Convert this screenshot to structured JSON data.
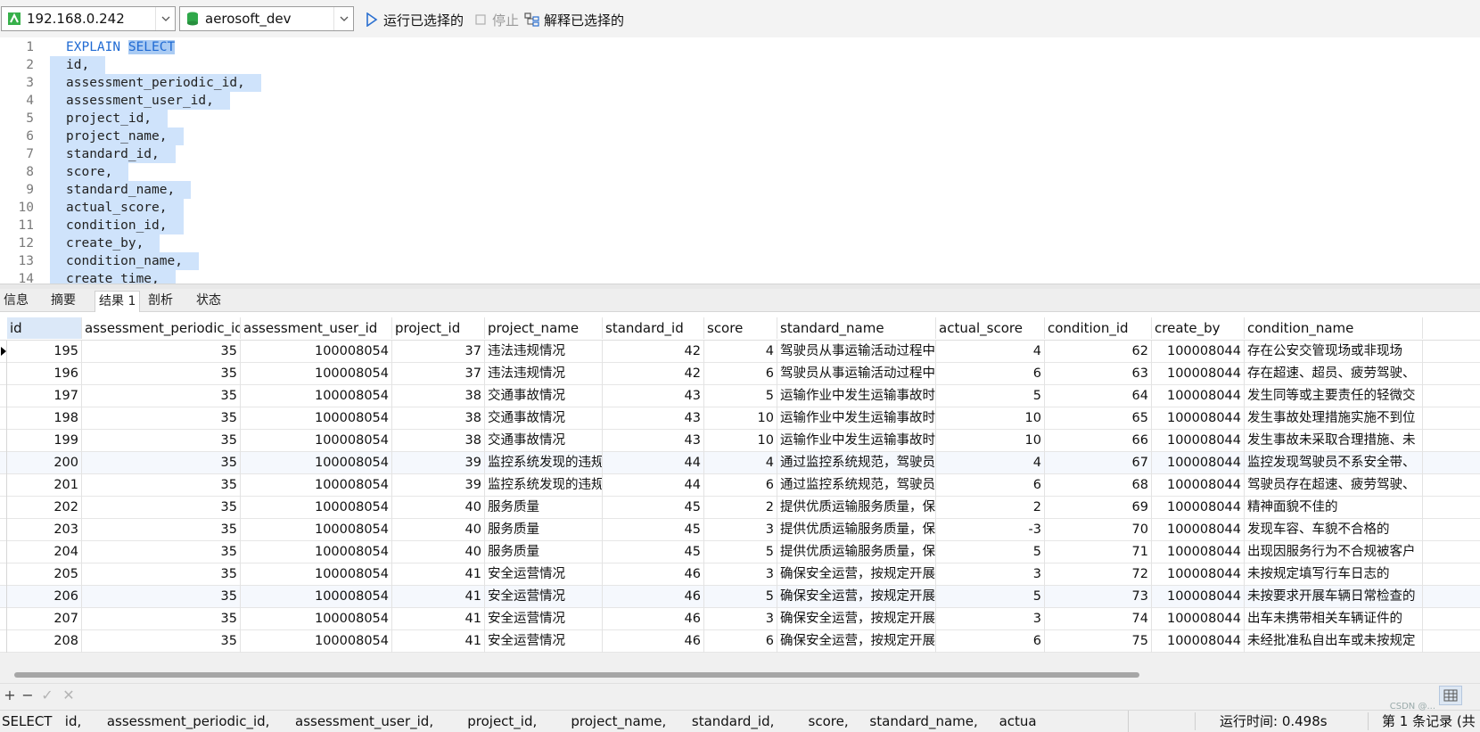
{
  "toolbar": {
    "connection": "192.168.0.242",
    "database": "aerosoft_dev",
    "run_selected": "运行已选择的",
    "stop": "停止",
    "explain_selected": "解释已选择的"
  },
  "editor": {
    "lines": [
      {
        "n": "1",
        "kw": "EXPLAIN",
        "kw2": "SELECT",
        "text": ""
      },
      {
        "n": "2",
        "text": "id,"
      },
      {
        "n": "3",
        "text": "assessment_periodic_id,"
      },
      {
        "n": "4",
        "text": "assessment_user_id,"
      },
      {
        "n": "5",
        "text": "project_id,"
      },
      {
        "n": "6",
        "text": "project_name,"
      },
      {
        "n": "7",
        "text": "standard_id,"
      },
      {
        "n": "8",
        "text": "score,"
      },
      {
        "n": "9",
        "text": "standard_name,"
      },
      {
        "n": "10",
        "text": "actual_score,"
      },
      {
        "n": "11",
        "text": "condition_id,"
      },
      {
        "n": "12",
        "text": "create_by,"
      },
      {
        "n": "13",
        "text": "condition_name,"
      },
      {
        "n": "14",
        "text": "create_time,"
      }
    ]
  },
  "tabs": [
    "信息",
    "摘要",
    "结果 1",
    "剖析",
    "状态"
  ],
  "active_tab": "结果 1",
  "grid": {
    "columns": [
      "id",
      "assessment_periodic_id",
      "assessment_user_id",
      "project_id",
      "project_name",
      "standard_id",
      "score",
      "standard_name",
      "actual_score",
      "condition_id",
      "create_by",
      "condition_name"
    ],
    "rows": [
      [
        "195",
        "35",
        "100008054",
        "37",
        "违法违规情况",
        "42",
        "4",
        "驾驶员从事运输活动过程中,",
        "4",
        "62",
        "100008044",
        "存在公安交管现场或非现场"
      ],
      [
        "196",
        "35",
        "100008054",
        "37",
        "违法违规情况",
        "42",
        "6",
        "驾驶员从事运输活动过程中,",
        "6",
        "63",
        "100008044",
        "存在超速、超员、疲劳驾驶、"
      ],
      [
        "197",
        "35",
        "100008054",
        "38",
        "交通事故情况",
        "43",
        "5",
        "运输作业中发生运输事故时及",
        "5",
        "64",
        "100008044",
        "发生同等或主要责任的轻微交"
      ],
      [
        "198",
        "35",
        "100008054",
        "38",
        "交通事故情况",
        "43",
        "10",
        "运输作业中发生运输事故时及",
        "10",
        "65",
        "100008044",
        "发生事故处理措施实施不到位"
      ],
      [
        "199",
        "35",
        "100008054",
        "38",
        "交通事故情况",
        "43",
        "10",
        "运输作业中发生运输事故时及",
        "10",
        "66",
        "100008044",
        "发生事故未采取合理措施、未"
      ],
      [
        "200",
        "35",
        "100008054",
        "39",
        "监控系统发现的违规",
        "44",
        "4",
        "通过监控系统规范，驾驶员和",
        "4",
        "67",
        "100008044",
        "监控发现驾驶员不系安全带、"
      ],
      [
        "201",
        "35",
        "100008054",
        "39",
        "监控系统发现的违规",
        "44",
        "6",
        "通过监控系统规范，驾驶员和",
        "6",
        "68",
        "100008044",
        "驾驶员存在超速、疲劳驾驶、"
      ],
      [
        "202",
        "35",
        "100008054",
        "40",
        "服务质量",
        "45",
        "2",
        "提供优质运输服务质量，保持",
        "2",
        "69",
        "100008044",
        "精神面貌不佳的"
      ],
      [
        "203",
        "35",
        "100008054",
        "40",
        "服务质量",
        "45",
        "3",
        "提供优质运输服务质量，保持",
        "-3",
        "70",
        "100008044",
        "发现车容、车貌不合格的"
      ],
      [
        "204",
        "35",
        "100008054",
        "40",
        "服务质量",
        "45",
        "5",
        "提供优质运输服务质量，保持",
        "5",
        "71",
        "100008044",
        "出现因服务行为不合规被客户"
      ],
      [
        "205",
        "35",
        "100008054",
        "41",
        "安全运营情况",
        "46",
        "3",
        "确保安全运营，按规定开展安",
        "3",
        "72",
        "100008044",
        "未按规定填写行车日志的"
      ],
      [
        "206",
        "35",
        "100008054",
        "41",
        "安全运营情况",
        "46",
        "5",
        "确保安全运营，按规定开展安",
        "5",
        "73",
        "100008044",
        "未按要求开展车辆日常检查的"
      ],
      [
        "207",
        "35",
        "100008054",
        "41",
        "安全运营情况",
        "46",
        "3",
        "确保安全运营，按规定开展安",
        "3",
        "74",
        "100008044",
        "出车未携带相关车辆证件的"
      ],
      [
        "208",
        "35",
        "100008054",
        "41",
        "安全运营情况",
        "46",
        "6",
        "确保安全运营，按规定开展安",
        "6",
        "75",
        "100008044",
        "未经批准私自出车或未按规定"
      ]
    ]
  },
  "status": {
    "sql_preview": "SELECT   id,      assessment_periodic_id,      assessment_user_id,        project_id,        project_name,      standard_id,        score,     standard_name,     actua",
    "run_time": "运行时间: 0.498s",
    "record": "第 1 条记录 (共",
    "watermark": "CSDN @..."
  },
  "icons": {
    "connection": "connection-icon",
    "database": "database-icon",
    "run": "run-icon",
    "stop": "stop-icon",
    "explain": "explain-icon"
  },
  "colors": {
    "selection": "#cfe3fb",
    "keyword": "#1f6ad3"
  }
}
